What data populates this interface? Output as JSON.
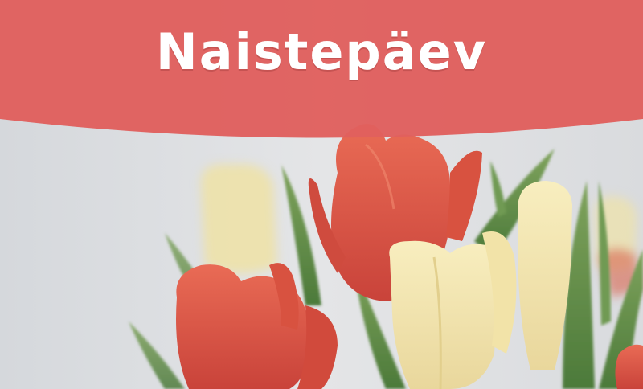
{
  "banner": {
    "title": "Naistepäev",
    "color": "#e0605e",
    "text_color": "#ffffff"
  },
  "photo": {
    "subject": "tulip-bouquet",
    "background_color": "#dfe1e4",
    "tulip_colors": [
      "#e0604a",
      "#f3e6b0",
      "#5f8f4a"
    ]
  }
}
